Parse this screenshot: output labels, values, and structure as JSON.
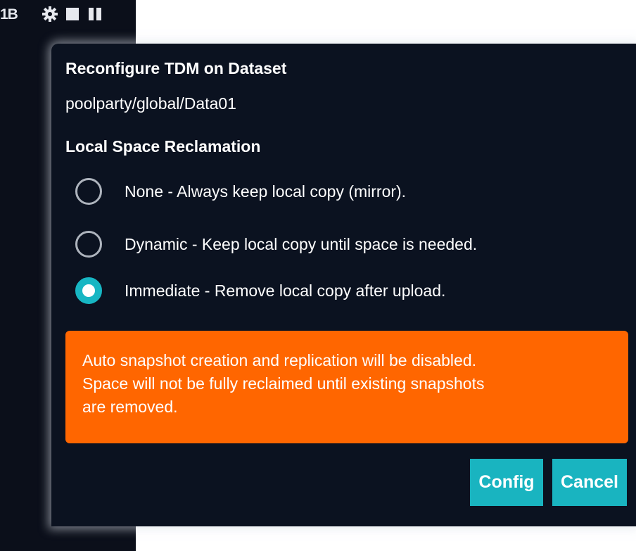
{
  "toolbar": {
    "size_text": "1B",
    "icons": [
      "gear-icon",
      "stop-icon",
      "pause-icon"
    ]
  },
  "dialog": {
    "title": "Reconfigure TDM on Dataset",
    "dataset_path": "poolparty/global/Data01",
    "section_heading": "Local Space Reclamation",
    "options": [
      {
        "label": "None - Always keep local copy (mirror).",
        "selected": false
      },
      {
        "label": "Dynamic - Keep local copy until space is needed.",
        "selected": false
      },
      {
        "label": "Immediate - Remove local copy after upload.",
        "selected": true
      }
    ],
    "warning": {
      "lines": [
        "Auto snapshot creation and replication will be disabled.",
        "Space will not be fully reclaimed until existing snapshots",
        "are removed."
      ]
    },
    "buttons": {
      "config": "Config",
      "cancel": "Cancel"
    }
  },
  "colors": {
    "dialog_bg": "#0b1220",
    "accent": "#19b4c0",
    "warning": "#ff6600",
    "background_dark": "#0b0f1a"
  }
}
